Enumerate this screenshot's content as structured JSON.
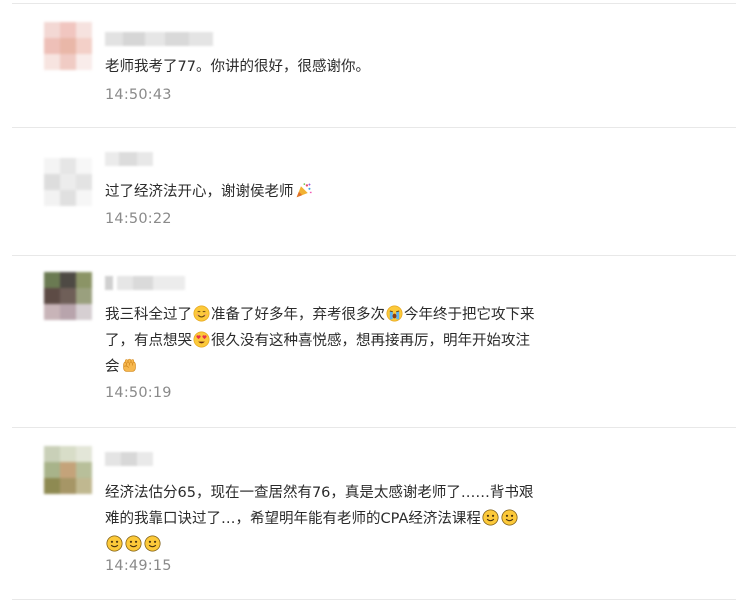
{
  "comments": [
    {
      "segments": [
        {
          "t": "老师我考了77。你讲的很好，很感谢你。"
        }
      ],
      "time": "14:50:43"
    },
    {
      "segments": [
        {
          "t": "过了经济法开心，谢谢侯老师"
        },
        {
          "icon": "party-popper-icon"
        }
      ],
      "time": "14:50:22"
    },
    {
      "segments": [
        {
          "t": "我三科全过了"
        },
        {
          "icon": "smiling-face-icon"
        },
        {
          "t": "准备了好多年，弃考很多次"
        },
        {
          "icon": "crying-face-icon"
        },
        {
          "t": "今年终于把它攻下来了，有点想哭"
        },
        {
          "icon": "heart-eyes-face-icon"
        },
        {
          "t": "很久没有这种喜悦感，想再接再厉，明年开始攻注会"
        },
        {
          "icon": "fist-icon"
        }
      ],
      "time": "14:50:19"
    },
    {
      "segments": [
        {
          "t": "经济法估分65，现在一查居然有76，真是太感谢老师了……背书艰难的我靠口诀过了…，希望明年能有老师的CPA经济法课程"
        },
        {
          "icon": "slight-smile-icon"
        },
        {
          "icon": "slight-smile-icon"
        },
        {
          "icon": "slight-smile-icon"
        },
        {
          "icon": "slight-smile-icon"
        },
        {
          "icon": "slight-smile-icon"
        }
      ],
      "time": "14:49:15"
    }
  ]
}
